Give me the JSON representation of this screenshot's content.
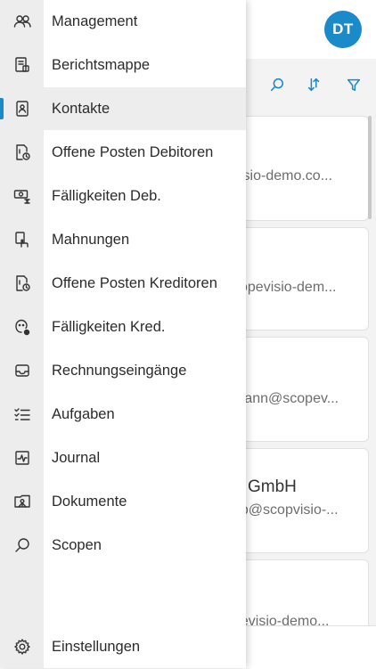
{
  "header": {
    "avatar_initials": "DT"
  },
  "toolbar": {
    "search_icon": "search-icon",
    "sort_icon": "sort-icon",
    "filter_icon": "filter-icon"
  },
  "cards": [
    {
      "title": "",
      "email": "visio-demo.co..."
    },
    {
      "title": "",
      "email": "copevisio-dem..."
    },
    {
      "title": "",
      "email": "mann@scopev..."
    },
    {
      "title": "GmbH",
      "email": "op@scopvisio-..."
    },
    {
      "title": "",
      "email": "pevisio-demo..."
    }
  ],
  "nav": {
    "items": [
      {
        "label": "Management",
        "icon": "users-icon"
      },
      {
        "label": "Berichtsmappe",
        "icon": "report-folder-icon"
      },
      {
        "label": "Kontakte",
        "icon": "contacts-icon",
        "active": true
      },
      {
        "label": "Offene Posten Debitoren",
        "icon": "open-items-debtors-icon"
      },
      {
        "label": "Fälligkeiten Deb.",
        "icon": "due-debtors-icon"
      },
      {
        "label": "Mahnungen",
        "icon": "dunning-icon"
      },
      {
        "label": "Offene Posten Kreditoren",
        "icon": "open-items-creditors-icon"
      },
      {
        "label": "Fälligkeiten Kred.",
        "icon": "due-creditors-icon"
      },
      {
        "label": "Rechnungseingänge",
        "icon": "inbox-icon"
      },
      {
        "label": "Aufgaben",
        "icon": "tasks-icon"
      },
      {
        "label": "Journal",
        "icon": "journal-icon"
      },
      {
        "label": "Dokumente",
        "icon": "documents-icon"
      },
      {
        "label": "Scopen",
        "icon": "search-icon"
      }
    ],
    "settings": {
      "label": "Einstellungen",
      "icon": "settings-icon"
    }
  },
  "colors": {
    "accent": "#1a8ac9",
    "rail": "#ededed",
    "text": "#2b2b2b"
  }
}
